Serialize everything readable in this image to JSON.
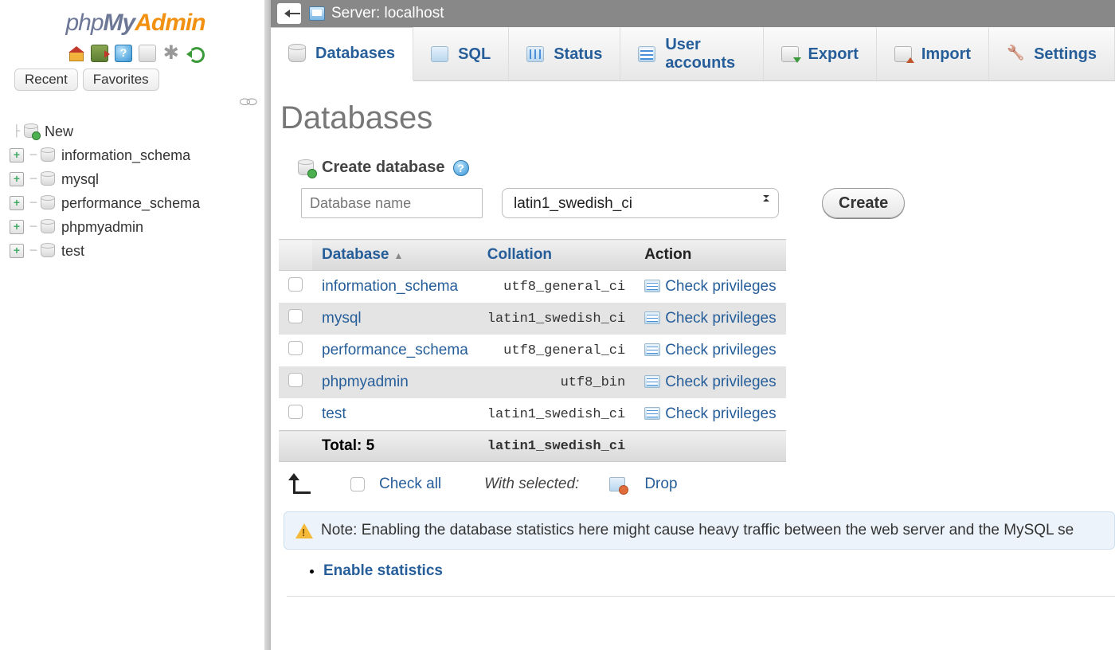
{
  "logo": {
    "p1": "php",
    "p2": "My",
    "p3": "Admin"
  },
  "sidebar": {
    "quick_tabs": {
      "recent": "Recent",
      "favorites": "Favorites"
    },
    "new_label": "New",
    "items": [
      {
        "label": "information_schema"
      },
      {
        "label": "mysql"
      },
      {
        "label": "performance_schema"
      },
      {
        "label": "phpmyadmin"
      },
      {
        "label": "test"
      }
    ]
  },
  "server_bar": {
    "label": "Server: localhost"
  },
  "tabs": [
    {
      "id": "databases",
      "label": "Databases",
      "icon": "db",
      "active": true
    },
    {
      "id": "sql",
      "label": "SQL",
      "icon": "sql"
    },
    {
      "id": "status",
      "label": "Status",
      "icon": "status"
    },
    {
      "id": "users",
      "label": "User accounts",
      "icon": "user"
    },
    {
      "id": "export",
      "label": "Export",
      "icon": "export"
    },
    {
      "id": "import",
      "label": "Import",
      "icon": "import"
    },
    {
      "id": "settings",
      "label": "Settings",
      "icon": "settings"
    }
  ],
  "page": {
    "heading": "Databases",
    "create_title": "Create database",
    "dbname_placeholder": "Database name",
    "collation_selected": "latin1_swedish_ci",
    "create_btn": "Create"
  },
  "table": {
    "headers": {
      "database": "Database",
      "collation": "Collation",
      "action": "Action"
    },
    "rows": [
      {
        "name": "information_schema",
        "collation": "utf8_general_ci",
        "action": "Check privileges"
      },
      {
        "name": "mysql",
        "collation": "latin1_swedish_ci",
        "action": "Check privileges"
      },
      {
        "name": "performance_schema",
        "collation": "utf8_general_ci",
        "action": "Check privileges"
      },
      {
        "name": "phpmyadmin",
        "collation": "utf8_bin",
        "action": "Check privileges"
      },
      {
        "name": "test",
        "collation": "latin1_swedish_ci",
        "action": "Check privileges"
      }
    ],
    "total_label": "Total: 5",
    "total_collation": "latin1_swedish_ci"
  },
  "bulk": {
    "check_all": "Check all",
    "with_selected": "With selected:",
    "drop": "Drop"
  },
  "note": "Note: Enabling the database statistics here might cause heavy traffic between the web server and the MySQL se",
  "enable_stats": "Enable statistics"
}
